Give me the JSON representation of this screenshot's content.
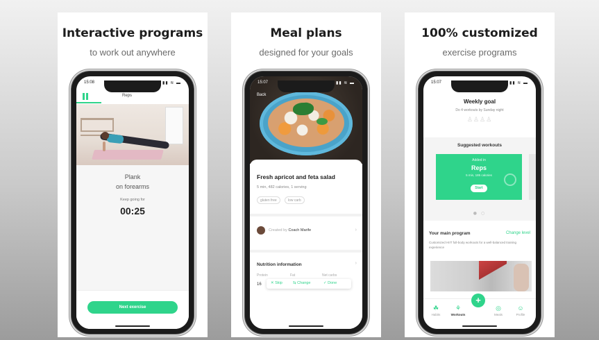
{
  "cards": [
    {
      "title": "Interactive programs",
      "subtitle": "to work out anywhere"
    },
    {
      "title": "Meal plans",
      "subtitle": "designed for your goals"
    },
    {
      "title": "100% customized",
      "subtitle": "exercise programs"
    }
  ],
  "screen1": {
    "time": "15:08",
    "status_icons": "▮▮ ≋ ▬",
    "tab_label": "Reps",
    "exercise_line1": "Plank",
    "exercise_line2": "on forearms",
    "keep_going": "Keep going for",
    "timer": "00:25",
    "next_button": "Next exercise"
  },
  "screen2": {
    "time": "15:07",
    "status_icons": "▮▮ ≋ ▬",
    "back_label": "Back",
    "recipe_title": "Fresh apricot and feta salad",
    "recipe_meta": "5 min, 482 calories, 1 serving",
    "tags": [
      "gluten free",
      "low carb"
    ],
    "created_by": "Created by",
    "coach_name": "Coach Marife",
    "nutrition_title": "Nutrition information",
    "columns": [
      "Protein",
      "Fat",
      "Net carbs"
    ],
    "protein_value": "16",
    "actions": {
      "skip": "Skip",
      "change": "Change",
      "done": "Done"
    },
    "accent": "#2fd48b"
  },
  "screen3": {
    "time": "15:07",
    "status_icons": "▮▮ ≋ ▬",
    "goal_title": "Weekly goal",
    "goal_sub": "Do 4 workouts by Sunday night",
    "goal_stars": "♙♙♙♙",
    "suggested_title": "Suggested workouts",
    "card_kicker": "Added in",
    "card_title": "Reps",
    "card_meta": "5 min, 185 calories",
    "start_label": "Start",
    "main_program": "Your main program",
    "change_level": "Change level",
    "program_desc": "Customized HIIT full-body workouts for a well-balanced training experience",
    "nav": [
      {
        "label": "Habits",
        "glyph": "☘"
      },
      {
        "label": "Workouts",
        "glyph": "⚘"
      },
      {
        "label": "Meals",
        "glyph": "◎"
      },
      {
        "label": "Profile",
        "glyph": "☺"
      }
    ],
    "plus": "+"
  }
}
